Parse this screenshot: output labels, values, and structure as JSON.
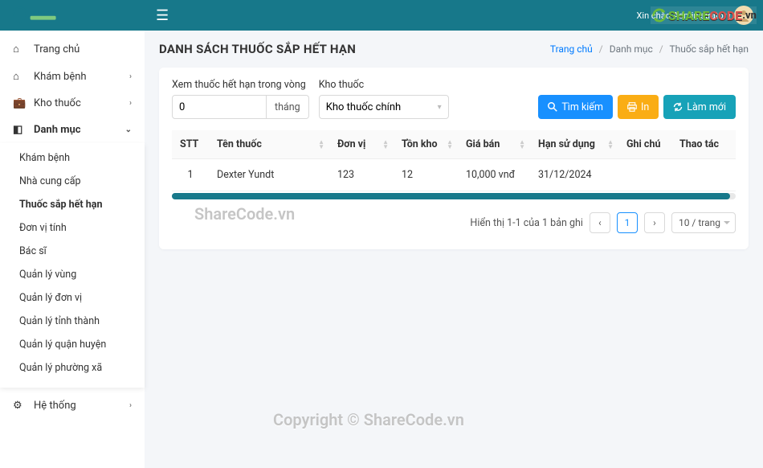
{
  "topbar": {
    "greeting": "Xin chào Administrator !"
  },
  "sidebar": {
    "items": [
      {
        "icon": "home",
        "label": "Trang chủ"
      },
      {
        "icon": "home2",
        "label": "Khám bệnh",
        "expandable": true
      },
      {
        "icon": "bag",
        "label": "Kho thuốc",
        "expandable": true
      },
      {
        "icon": "table",
        "label": "Danh mục",
        "expandable": true,
        "active": true
      }
    ],
    "submenu": [
      "Khám bệnh",
      "Nhà cung cấp",
      "Thuốc sắp hết hạn",
      "Đơn vị tính",
      "Bác sĩ",
      "Quản lý vùng",
      "Quản lý đơn vị",
      "Quản lý tỉnh thành",
      "Quản lý quận huyện",
      "Quản lý phường xã"
    ],
    "submenu_active_index": 2,
    "system": {
      "icon": "gear",
      "label": "Hệ thống"
    }
  },
  "page": {
    "title": "DANH SÁCH THUỐC SẮP HẾT HẠN",
    "breadcrumb": [
      "Trang chủ",
      "Danh mục",
      "Thuốc sắp hết hạn"
    ]
  },
  "filters": {
    "range_label": "Xem thuốc hết hạn trong vòng",
    "range_value": "0",
    "range_suffix": "tháng",
    "warehouse_label": "Kho thuốc",
    "warehouse_value": "Kho thuốc chính"
  },
  "buttons": {
    "search": "Tìm kiếm",
    "print": "In",
    "refresh": "Làm mới"
  },
  "table": {
    "headers": [
      "STT",
      "Tên thuốc",
      "Đơn vị",
      "Tồn kho",
      "Giá bán",
      "Hạn sử dụng",
      "Ghi chú",
      "Thao tác"
    ],
    "rows": [
      {
        "stt": "1",
        "ten": "Dexter Yundt",
        "donvi": "123",
        "tonkho": "12",
        "giaban": "10,000 vnđ",
        "hsd": "31/12/2024",
        "ghichu": "",
        "thaotac": ""
      }
    ]
  },
  "pagination": {
    "summary": "Hiển thị 1-1 của 1 bản ghi",
    "current": "1",
    "size": "10 / trang"
  },
  "watermarks": {
    "w1": "ShareCode.vn",
    "w2": "Copyright © ShareCode.vn",
    "badge_domain": ".vn",
    "badge_text1": "SHARE",
    "badge_text2": "CODE"
  }
}
